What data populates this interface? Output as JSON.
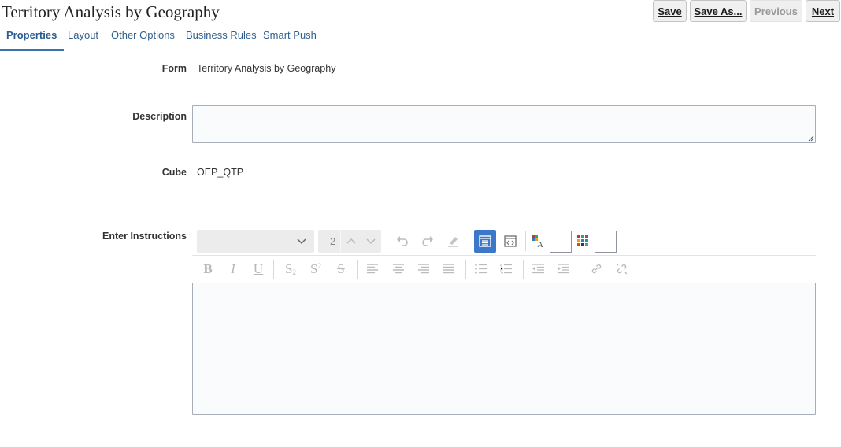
{
  "page_title": "Territory Analysis by Geography",
  "buttons": {
    "save": "Save",
    "save_as": "Save As...",
    "previous": "Previous",
    "next": "Next"
  },
  "tabs": [
    "Properties",
    "Layout",
    "Other Options",
    "Business Rules",
    "Smart Push"
  ],
  "active_tab": "Properties",
  "form": {
    "form_label": "Form",
    "form_value": "Territory Analysis by Geography",
    "description_label": "Description",
    "description_value": "",
    "cube_label": "Cube",
    "cube_value": "OEP_QTP",
    "instructions_label": "Enter Instructions",
    "instructions_value": ""
  },
  "editor_toolbar": {
    "font_size_value": "2",
    "icons_row1": [
      "chevron-down-icon",
      "chevron-up-icon",
      "chevron-down-icon",
      "undo-icon",
      "redo-icon",
      "clear-format-icon",
      "rich-text-mode-icon",
      "source-mode-icon",
      "font-color-icon",
      "background-color-icon"
    ],
    "icons_row2": [
      "bold-icon",
      "italic-icon",
      "underline-icon",
      "subscript-icon",
      "superscript-icon",
      "strikethrough-icon",
      "align-left-icon",
      "align-center-icon",
      "align-right-icon",
      "justify-icon",
      "bulleted-list-icon",
      "numbered-list-icon",
      "outdent-icon",
      "indent-icon",
      "link-icon",
      "unlink-icon"
    ]
  },
  "colors": {
    "accent": "#3a73b5",
    "link": "#2f5f8f",
    "active_toolbar": "#3b78c9"
  }
}
